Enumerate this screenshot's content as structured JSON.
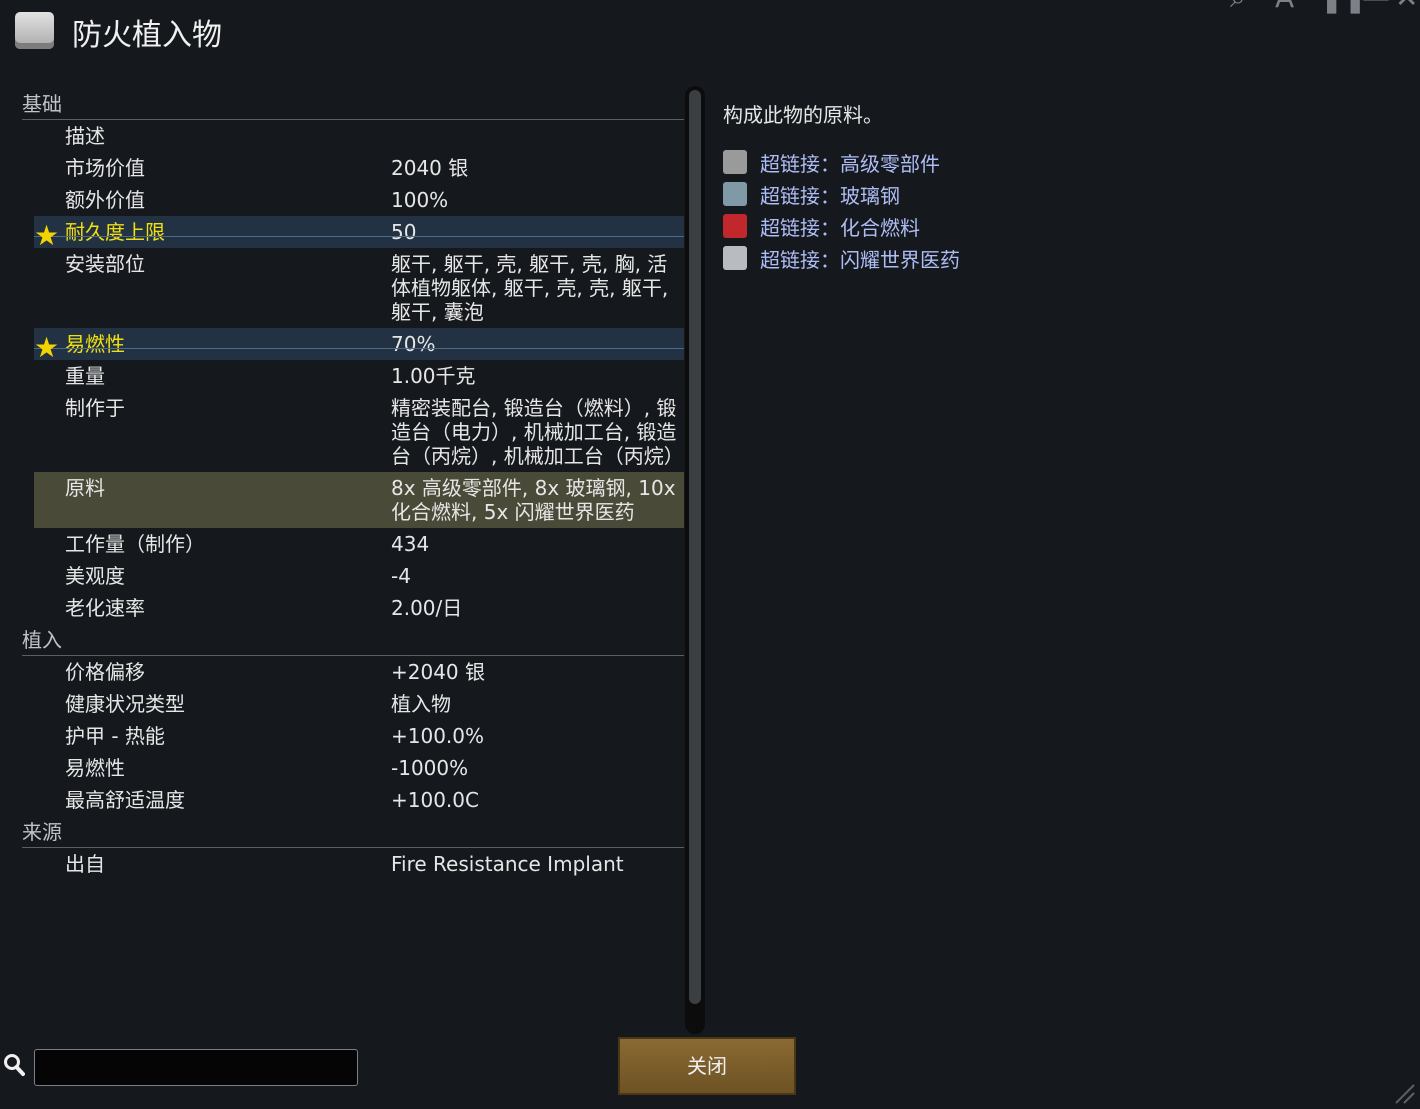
{
  "window": {
    "title": "防火植入物"
  },
  "sections": [
    {
      "name": "基础",
      "rows": [
        {
          "label": "描述",
          "value": ""
        },
        {
          "label": "市场价值",
          "value": "2040 银"
        },
        {
          "label": "额外价值",
          "value": "100%"
        },
        {
          "label": "耐久度上限",
          "value": "50",
          "highlighted": true
        },
        {
          "label": "安装部位",
          "value": "躯干, 躯干, 壳, 躯干, 壳, 胸, 活体植物躯体, 躯干, 壳, 壳, 躯干, 躯干, 囊泡"
        },
        {
          "label": "易燃性",
          "value": "70%",
          "highlighted": true
        },
        {
          "label": "重量",
          "value": "1.00千克"
        },
        {
          "label": "制作于",
          "value": "精密装配台, 锻造台（燃料）, 锻造台（电力）, 机械加工台, 锻造台（丙烷）, 机械加工台（丙烷）"
        },
        {
          "label": "原料",
          "value": "8x 高级零部件, 8x 玻璃钢, 10x 化合燃料, 5x 闪耀世界医药",
          "selected": true
        },
        {
          "label": "工作量（制作）",
          "value": "434"
        },
        {
          "label": "美观度",
          "value": "-4"
        },
        {
          "label": "老化速率",
          "value": "2.00/日"
        }
      ]
    },
    {
      "name": "植入",
      "rows": [
        {
          "label": "价格偏移",
          "value": "+2040 银"
        },
        {
          "label": "健康状况类型",
          "value": "植入物"
        },
        {
          "label": "护甲 - 热能",
          "value": "+100.0%"
        },
        {
          "label": "易燃性",
          "value": "-1000%"
        },
        {
          "label": "最高舒适温度",
          "value": "+100.0C"
        }
      ]
    },
    {
      "name": "来源",
      "rows": [
        {
          "label": "出自",
          "value": "Fire Resistance Implant"
        }
      ]
    }
  ],
  "detail": {
    "description": "构成此物的原料。",
    "links": [
      {
        "text": "超链接：高级零部件",
        "icon": "component-icon",
        "color": "#9a9a9a"
      },
      {
        "text": "超链接：玻璃钢",
        "icon": "plasteel-icon",
        "color": "#7f9aa6"
      },
      {
        "text": "超链接：化合燃料",
        "icon": "fuel-icon",
        "color": "#c0282c"
      },
      {
        "text": "超链接：闪耀世界医药",
        "icon": "medicine-icon",
        "color": "#b8bcc0"
      }
    ]
  },
  "search": {
    "value": "",
    "placeholder": ""
  },
  "buttons": {
    "close": "关闭"
  },
  "colors": {
    "highlight_label": "#f0e010",
    "link": "#aebdf4",
    "highlight_row": "#233243",
    "selected_row": "#4a4a38"
  }
}
